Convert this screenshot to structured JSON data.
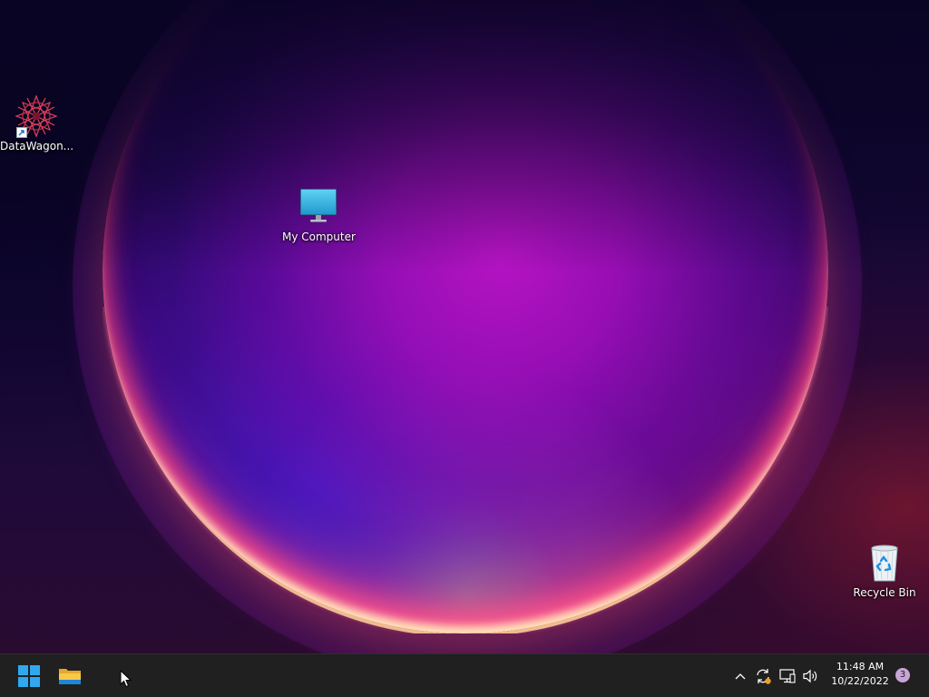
{
  "desktop": {
    "icons": [
      {
        "label": "DataWagon...",
        "icon": "datawagon-app-icon",
        "shortcut": true
      },
      {
        "label": "My Computer",
        "icon": "monitor-icon"
      },
      {
        "label": "Recycle Bin",
        "icon": "recycle-bin-icon"
      }
    ]
  },
  "taskbar": {
    "start_icon": "windows-start-icon",
    "pinned": [
      {
        "icon": "file-explorer-icon"
      }
    ],
    "tray": {
      "icons": [
        "chevron-up-icon",
        "sync-icon",
        "network-icon",
        "volume-icon"
      ]
    },
    "clock": {
      "time": "11:48 AM",
      "date": "10/22/2022"
    },
    "notifications": {
      "count": "3"
    }
  },
  "colors": {
    "taskbar_bg": "#202020",
    "start_blue": "#2fa8f0",
    "monitor_blue": "#3ab8e0",
    "badge": "#c9a4d6"
  }
}
